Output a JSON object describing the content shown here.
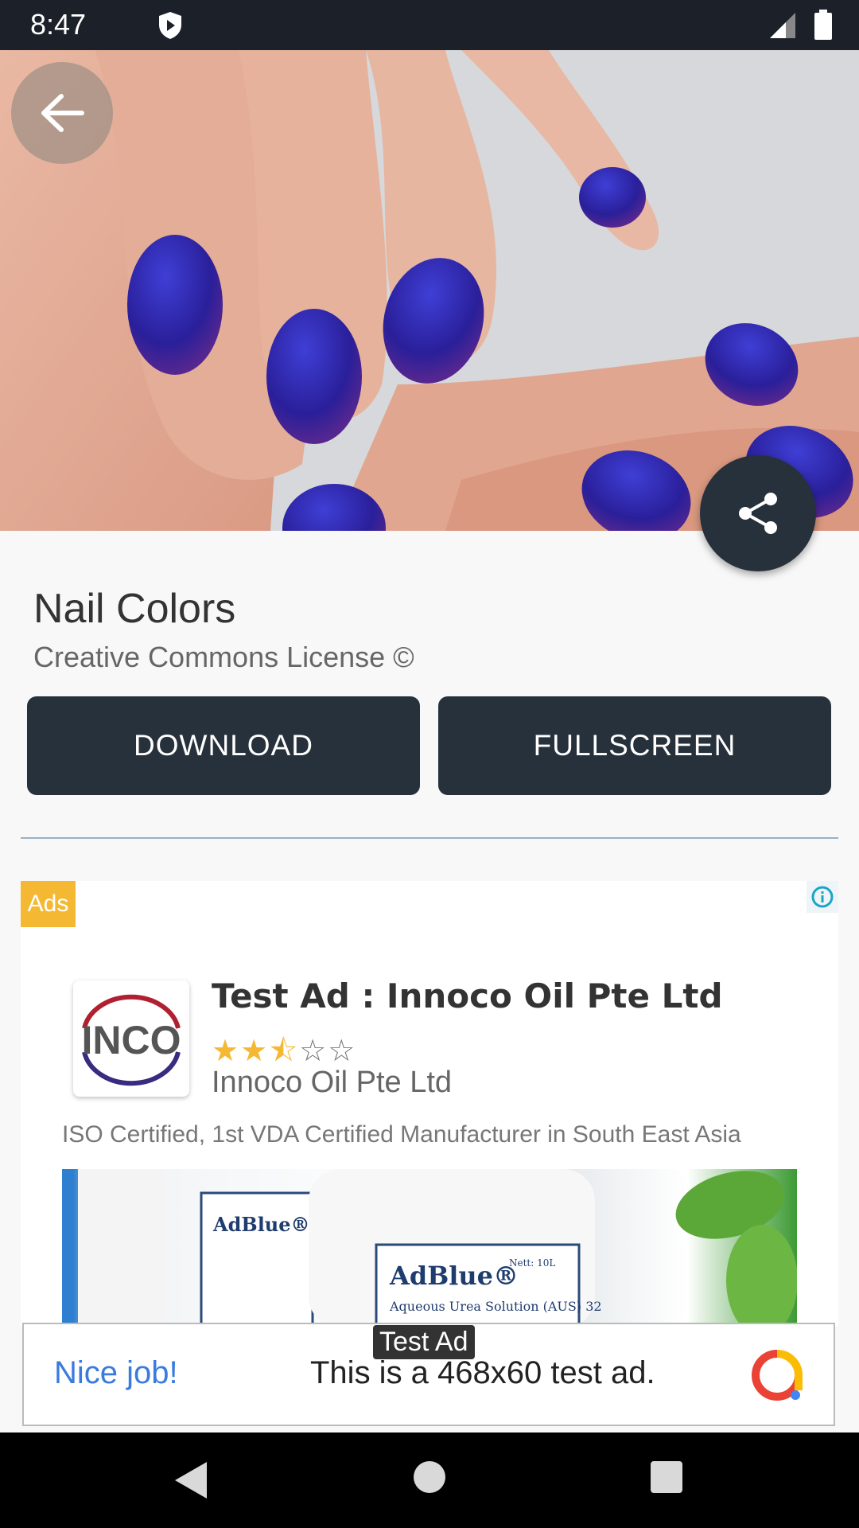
{
  "status_bar": {
    "time": "8:47",
    "icons": [
      "shield-icon",
      "signal-icon",
      "battery-icon"
    ]
  },
  "hero": {
    "image_description_icon": "nail-photo-image",
    "back_icon": "arrow-left-icon",
    "share_icon": "share-icon"
  },
  "detail": {
    "title": "Nail Colors",
    "license": "Creative Commons License ©",
    "download_label": "DOWNLOAD",
    "fullscreen_label": "FULLSCREEN"
  },
  "native_ad": {
    "badge": "Ads",
    "logo_text": "INCO",
    "headline": "Test Ad : Innoco Oil Pte Ltd",
    "rating": 2.5,
    "rating_max": 5,
    "advertiser": "Innoco Oil Pte Ltd",
    "body": "ISO Certified, 1st VDA Certified Manufacturer in South East Asia",
    "image_labels": [
      "AdBlue®",
      "AdBlue®",
      "Aqueous Urea Solution (AUS) 32",
      "Nett: 10L"
    ]
  },
  "banner_ad": {
    "label": "Test Ad",
    "nice": "Nice job!",
    "text": "This is a 468x60 test ad."
  },
  "colors": {
    "button_bg": "#27313c",
    "ads_badge": "#f5b832",
    "nice_blue": "#3a7be0"
  }
}
